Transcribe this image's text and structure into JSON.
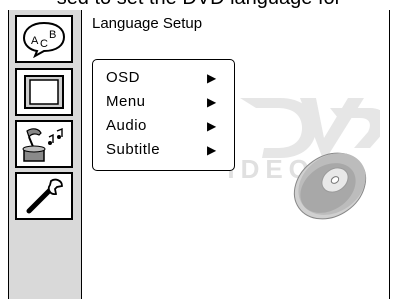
{
  "caption": "sed to set the DVD language for",
  "screen_title": "Language Setup",
  "sidebar": {
    "items": [
      {
        "name": "language",
        "icon": "abc-speech-icon",
        "text": "ABC",
        "selected": true
      },
      {
        "name": "video",
        "icon": "tv-icon"
      },
      {
        "name": "audio",
        "icon": "gramophone-icon"
      },
      {
        "name": "tools",
        "icon": "wrench-icon"
      }
    ]
  },
  "menu": {
    "items": [
      {
        "label": "OSD",
        "arrow": "▶"
      },
      {
        "label": "Menu",
        "arrow": "▶"
      },
      {
        "label": "Audio",
        "arrow": "▶"
      },
      {
        "label": "Subtitle",
        "arrow": "▶"
      }
    ]
  },
  "logo": {
    "text": "VIDEO",
    "icon": "dvd-video-logo"
  },
  "colors": {
    "sidebar_bg": "#d9d9d9",
    "frame": "#000000",
    "watermark": "#e6e6e6"
  }
}
